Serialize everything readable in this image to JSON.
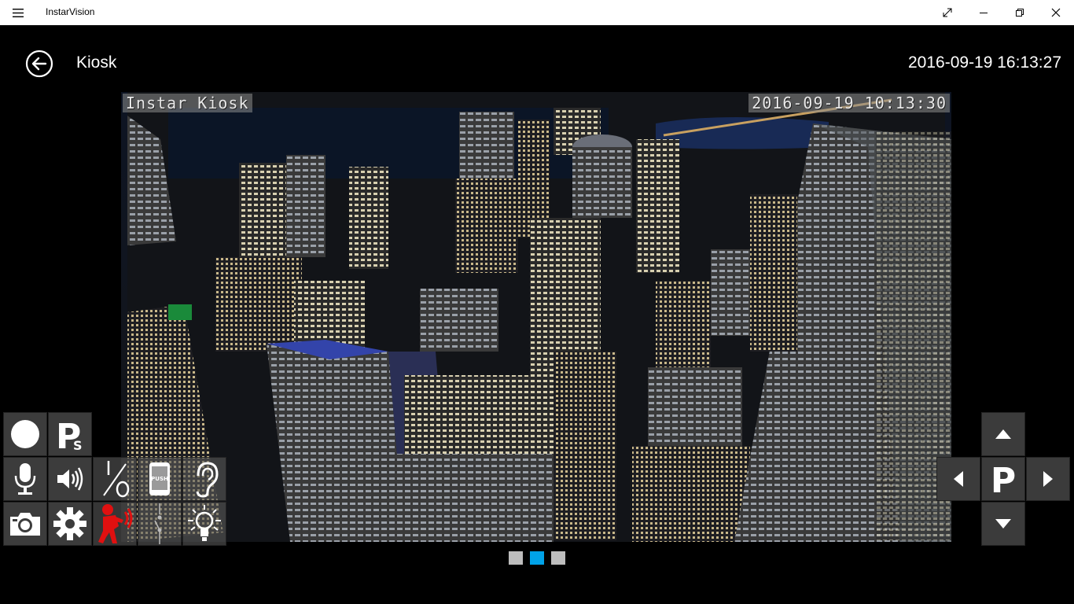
{
  "app": {
    "title": "InstarVision"
  },
  "header": {
    "camera_name": "Kiosk",
    "datetime": "2016-09-19 16:13:27"
  },
  "video": {
    "osd_name": "Instar Kiosk",
    "osd_time": "2016-09-19 10:13:30"
  },
  "controls": {
    "push_label": "PUSH",
    "left_column": [
      "record-icon",
      "ps-icon",
      "microphone-icon",
      "speaker-icon",
      "io-icon",
      "push-icon",
      "ear-icon",
      "camera-icon",
      "gear-icon",
      "alarm-icon",
      "switch-icon",
      "lightbulb-icon"
    ],
    "ptz": {
      "park_label": "P",
      "buttons": [
        "up-arrow-icon",
        "left-arrow-icon",
        "park-icon",
        "right-arrow-icon",
        "down-arrow-icon"
      ]
    },
    "ps_label": "P",
    "ps_sub": "S"
  },
  "pagination": {
    "pages": 3,
    "active": 2
  },
  "colors": {
    "accent": "#00a2e8",
    "alarm": "#e01010",
    "button_bg": "#3c3c3c"
  }
}
